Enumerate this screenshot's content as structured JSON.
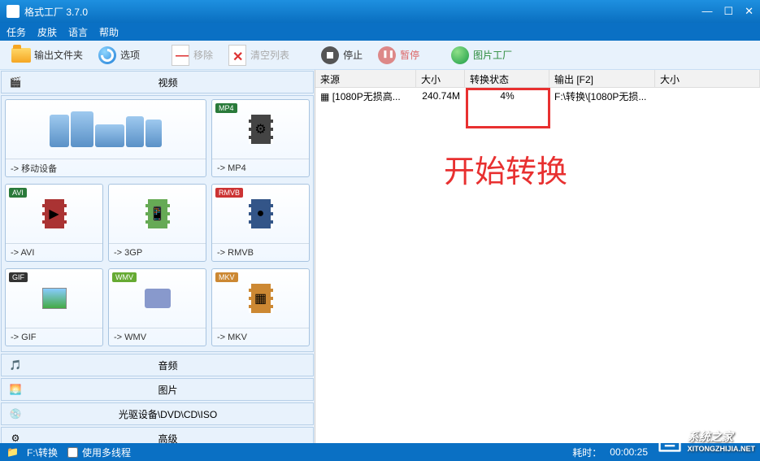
{
  "window": {
    "title": "格式工厂 3.7.0"
  },
  "menu": {
    "task": "任务",
    "skin": "皮肤",
    "language": "语言",
    "help": "帮助"
  },
  "toolbar": {
    "output_folder": "输出文件夹",
    "options": "选项",
    "remove": "移除",
    "clear_list": "清空列表",
    "stop": "停止",
    "pause": "暂停",
    "pic_factory": "图片工厂"
  },
  "categories": {
    "video": "视频",
    "audio": "音频",
    "picture": "图片",
    "disc": "光驱设备\\DVD\\CD\\ISO",
    "advanced": "高级"
  },
  "tiles": {
    "devices": "-> 移动设备",
    "mp4": {
      "label": "-> MP4",
      "badge": "MP4"
    },
    "avi": {
      "label": "-> AVI",
      "badge": "AVI"
    },
    "3gp": {
      "label": "-> 3GP"
    },
    "rmvb": {
      "label": "-> RMVB",
      "badge": "RMVB"
    },
    "gif": {
      "label": "-> GIF",
      "badge": "GIF"
    },
    "wmv": {
      "label": "-> WMV",
      "badge": "WMV"
    },
    "mkv": {
      "label": "-> MKV",
      "badge": "MKV"
    }
  },
  "table": {
    "headers": {
      "source": "来源",
      "size": "大小",
      "status": "转换状态",
      "output": "输出 [F2]",
      "size2": "大小"
    },
    "row": {
      "source": "[1080P无损高...",
      "size": "240.74M",
      "status": "4%",
      "output": "F:\\转换\\[1080P无损..."
    }
  },
  "annotation": {
    "text": "开始转换"
  },
  "statusbar": {
    "path": "F:\\转换",
    "multithread": "使用多线程",
    "elapsed_label": "耗时：",
    "elapsed_value": "00:00:25"
  },
  "watermark": {
    "text1": "系统之家",
    "text2": "XITONGZHIJIA.NET"
  }
}
